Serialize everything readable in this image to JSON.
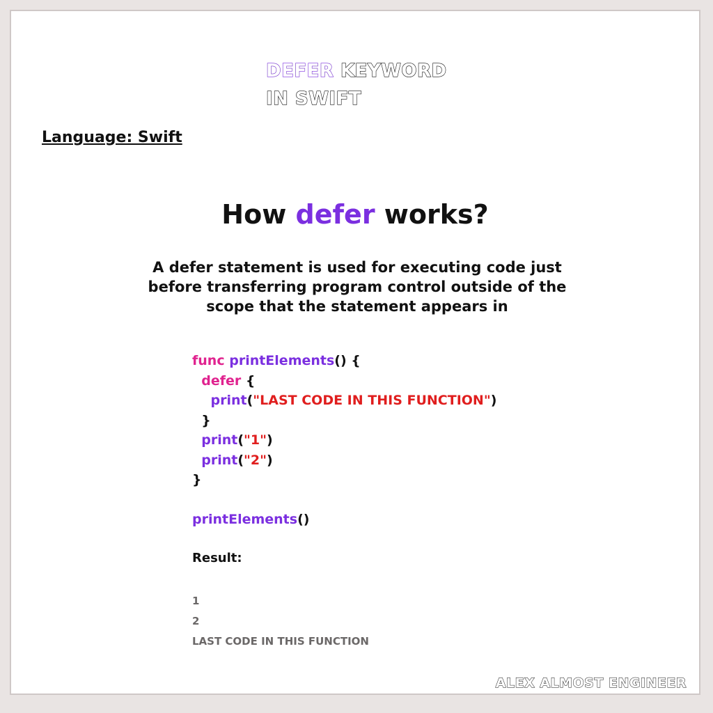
{
  "header": {
    "title_accent": "DEFER",
    "title_rest": " KEYWORD",
    "title_line2": "IN SWIFT"
  },
  "language_label": "Language: Swift",
  "heading": {
    "pre": "How ",
    "accent": "defer",
    "post": " works?"
  },
  "description": "A defer statement is used for executing code just before transferring program control outside of the scope that the statement appears in",
  "code": {
    "line1_kw": "func",
    "line1_fn": "printElements",
    "line1_rest": "() {",
    "line2_kw": "defer",
    "line2_rest": " {",
    "line3_fn": "print",
    "line3_str": "\"LAST CODE IN THIS FUNCTION\"",
    "line4": "}",
    "line5_fn": "print",
    "line5_str": "\"1\"",
    "line6_fn": "print",
    "line6_str": "\"2\"",
    "line7": "}",
    "call_fn": "printElements",
    "call_rest": "()"
  },
  "result_label": "Result:",
  "output": [
    "1",
    "2",
    "LAST CODE IN THIS FUNCTION"
  ],
  "footer": "ALEX ALMOST ENGINEER",
  "colors": {
    "accent_purple": "#7b2fe0",
    "keyword_pink": "#e0238f",
    "string_red": "#e01e1e"
  }
}
